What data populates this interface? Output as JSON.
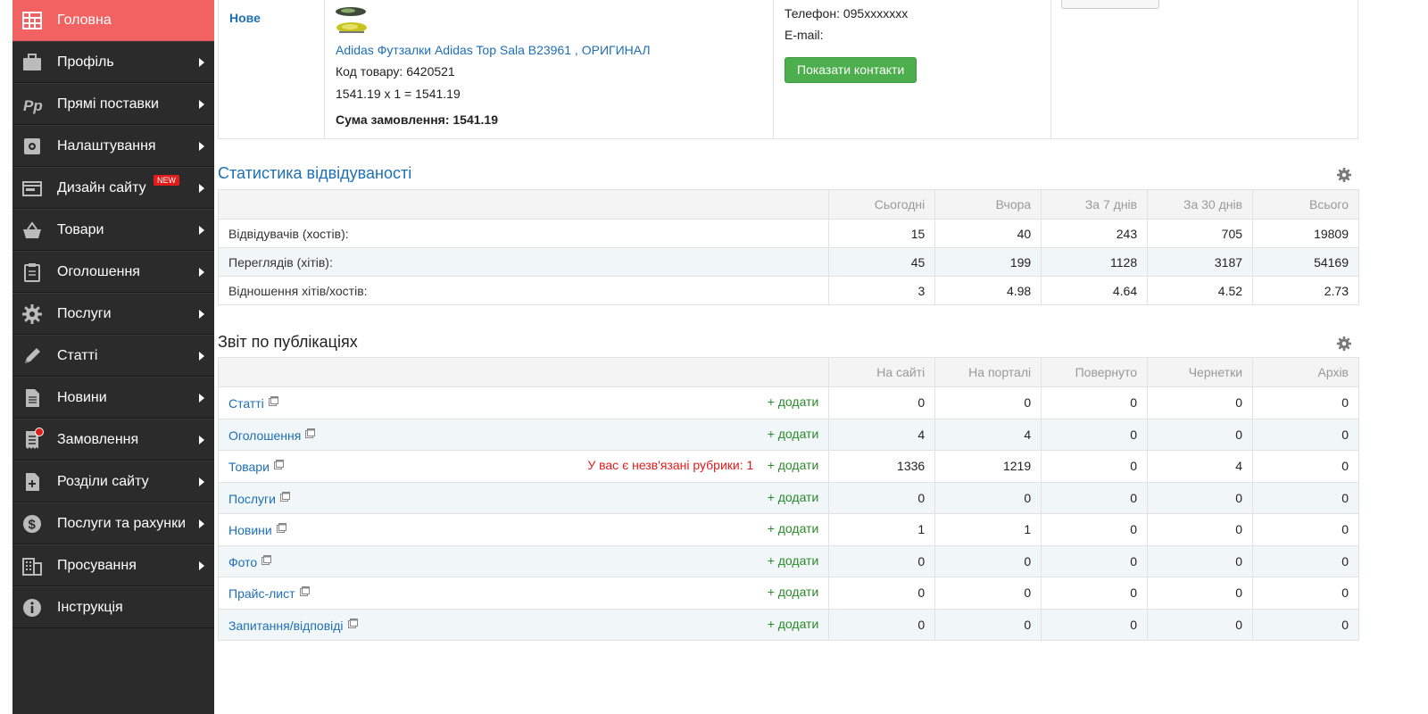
{
  "sidebar": {
    "items": [
      {
        "label": "Головна",
        "icon": "grid-icon",
        "active": true,
        "arrow": false
      },
      {
        "label": "Профіль",
        "icon": "briefcase-icon",
        "arrow": true
      },
      {
        "label": "Прямі поставки",
        "icon": "pp-icon",
        "arrow": true
      },
      {
        "label": "Налаштування",
        "icon": "settings-box-icon",
        "arrow": true
      },
      {
        "label": "Дизайн сайту",
        "icon": "layout-icon",
        "arrow": true,
        "badge": "NEW"
      },
      {
        "label": "Товари",
        "icon": "basket-icon",
        "arrow": true
      },
      {
        "label": "Оголошення",
        "icon": "clipboard-icon",
        "arrow": true
      },
      {
        "label": "Послуги",
        "icon": "gear-icon",
        "arrow": true
      },
      {
        "label": "Статті",
        "icon": "pencil-icon",
        "arrow": true
      },
      {
        "label": "Новини",
        "icon": "document-icon",
        "arrow": true
      },
      {
        "label": "Замовлення",
        "icon": "receipt-icon",
        "arrow": true,
        "notification_dot": true
      },
      {
        "label": "Розділи сайту",
        "icon": "add-file-icon",
        "arrow": true
      },
      {
        "label": "Послуги та рахунки",
        "icon": "dollar-icon",
        "arrow": true
      },
      {
        "label": "Просування",
        "icon": "building-icon",
        "arrow": true
      },
      {
        "label": "Інструкція",
        "icon": "info-icon",
        "arrow": false
      }
    ]
  },
  "order": {
    "status": "Нове",
    "product_name": "Adidas Футзалки Adidas Top Sala B23961 , ОРИГИНАЛ",
    "product_code": "Код товару: 6420521",
    "calc": "1541.19 x 1 = 1541.19",
    "sum_label": "Сума замовлення: 1541.19",
    "phone": "Телефон: 095xxxxxxx",
    "email": "E-mail:",
    "show_contacts": "Показати контакти"
  },
  "stats": {
    "title": "Статистика відвідуваності",
    "columns": [
      "Сьогодні",
      "Вчора",
      "За 7 днів",
      "За 30 днів",
      "Всього"
    ],
    "rows": [
      {
        "label": "Відвідувачів (хостів):",
        "values": [
          "15",
          "40",
          "243",
          "705",
          "19809"
        ]
      },
      {
        "label": "Переглядів (хітів):",
        "values": [
          "45",
          "199",
          "1128",
          "3187",
          "54169"
        ]
      },
      {
        "label": "Відношення хітів/хостів:",
        "values": [
          "3",
          "4.98",
          "4.64",
          "4.52",
          "2.73"
        ]
      }
    ]
  },
  "pubs": {
    "title": "Звіт по публікаціях",
    "columns": [
      "На сайті",
      "На порталі",
      "Повернуто",
      "Чернетки",
      "Архів"
    ],
    "add_label": "+ додати",
    "rows": [
      {
        "label": "Статті",
        "values": [
          "0",
          "0",
          "0",
          "0",
          "0"
        ]
      },
      {
        "label": "Оголошення",
        "values": [
          "4",
          "4",
          "0",
          "0",
          "0"
        ]
      },
      {
        "label": "Товари",
        "warning": "У вас є незв'язані рубрики: 1",
        "values": [
          "1336",
          "1219",
          "0",
          "4",
          "0"
        ]
      },
      {
        "label": "Послуги",
        "values": [
          "0",
          "0",
          "0",
          "0",
          "0"
        ]
      },
      {
        "label": "Новини",
        "values": [
          "1",
          "1",
          "0",
          "0",
          "0"
        ]
      },
      {
        "label": "Фото",
        "values": [
          "0",
          "0",
          "0",
          "0",
          "0"
        ]
      },
      {
        "label": "Прайс-лист",
        "values": [
          "0",
          "0",
          "0",
          "0",
          "0"
        ]
      },
      {
        "label": "Запитання/відповіді",
        "values": [
          "0",
          "0",
          "0",
          "0",
          "0"
        ]
      }
    ]
  },
  "colors": {
    "sidebar_bg": "#2b2b2b",
    "active_item": "#f26262",
    "link": "#1e6fb6",
    "add": "#2a8a2a",
    "warning": "#e21b1b",
    "button_green": "#4cae4c"
  }
}
